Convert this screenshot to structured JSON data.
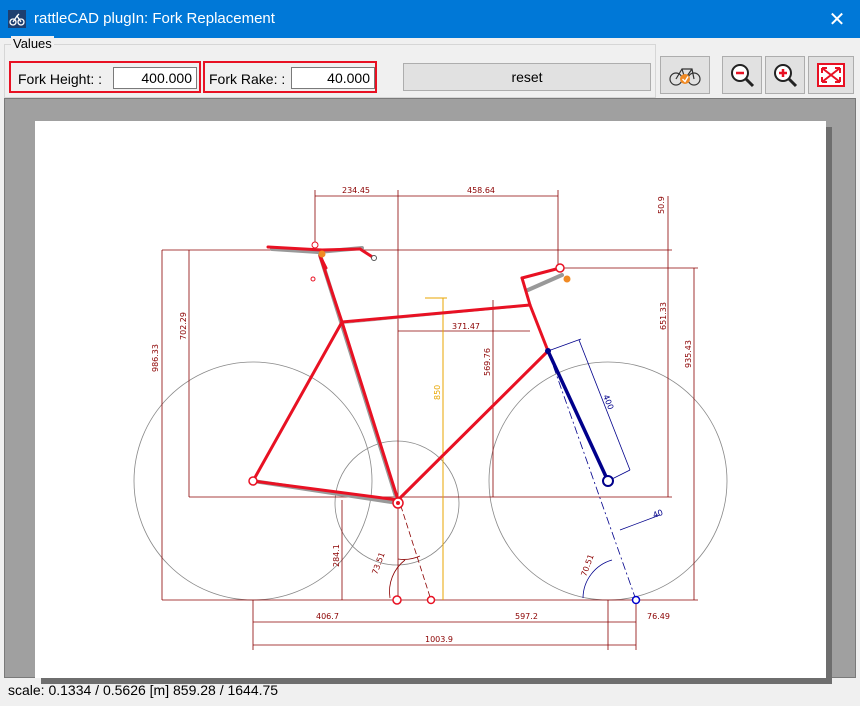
{
  "window": {
    "title": "rattleCAD plugIn: Fork Replacement",
    "close_glyph": "✕"
  },
  "values": {
    "group_label": "Values",
    "fork_height": {
      "label": "Fork Height: :",
      "value": "400.000"
    },
    "fork_rake": {
      "label": "Fork Rake: :",
      "value": "40.000"
    },
    "reset_label": "reset"
  },
  "toolbar": {
    "buttons": [
      {
        "name": "bike-render-icon"
      },
      {
        "name": "zoom-out-icon"
      },
      {
        "name": "zoom-in-icon"
      },
      {
        "name": "fit-to-window-icon"
      }
    ]
  },
  "drawing": {
    "dimensions": {
      "d1": "234.45",
      "d2": "458.64",
      "d3": "50.9",
      "d4": "986.33",
      "d5": "702.29",
      "d6": "651.33",
      "d7": "935.43",
      "d8": "371.47",
      "d9": "850",
      "d10": "569.76",
      "d11": "400",
      "d12": "284.1",
      "d13": "73.51",
      "d14": "70.51",
      "d15": "40",
      "d16": "406.7",
      "d17": "597.2",
      "d18": "76.49",
      "d19": "1003.9",
      "angle_unit": "°"
    }
  },
  "status": {
    "text": "scale: 0.1334 / 0.5626  [m]  859.28 / 1644.75"
  }
}
